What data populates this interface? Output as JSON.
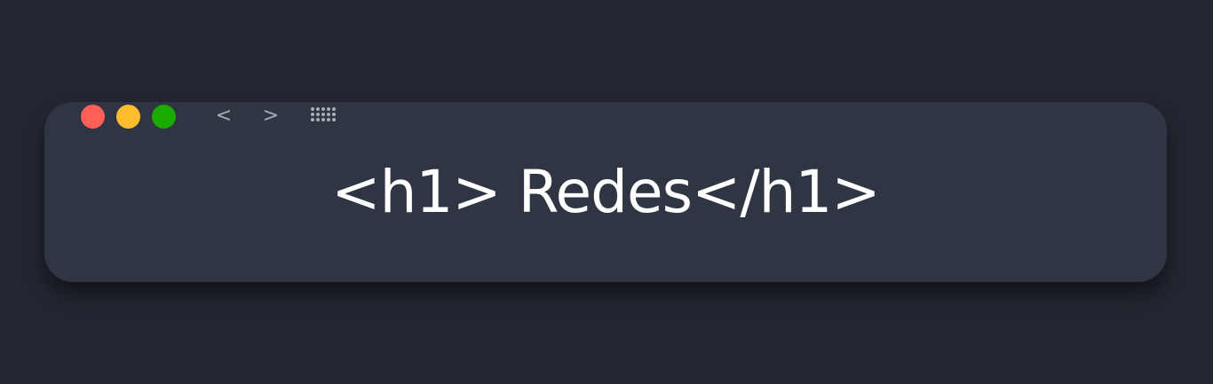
{
  "window": {
    "controls": {
      "close_color": "#ff5f57",
      "minimize_color": "#ffbd2e",
      "maximize_color": "#1aab00"
    },
    "nav": {
      "back_icon": "<",
      "forward_icon": ">",
      "grid_icon": "apps-grid-icon"
    },
    "content": {
      "heading": "<h1> Redes</h1>"
    }
  }
}
